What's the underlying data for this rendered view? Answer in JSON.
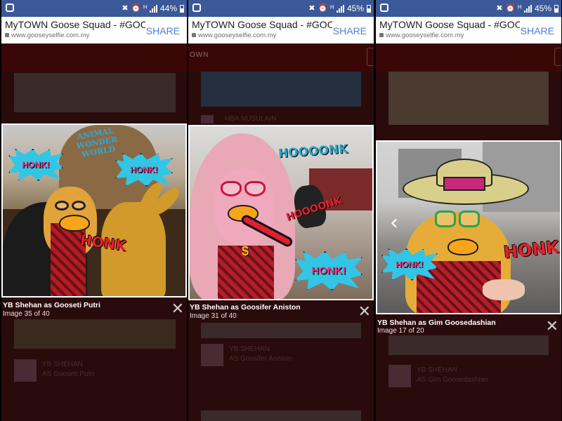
{
  "panels": [
    {
      "status": {
        "battery": "44%"
      },
      "browser": {
        "title": "MyTOWN Goose Squad - #GOOS...",
        "url": "www.gooseyselfie.com.my",
        "share": "SHARE"
      },
      "stickers": [
        "HONK!",
        "HONK!",
        "HONK"
      ],
      "sign": "ANIMAL WONDER WORLD",
      "caption": "YB Shehan as Gooseti Putri",
      "counter": "Image 35 of 40",
      "below": {
        "name_line1": "YB SHEHAN",
        "name_line2": "AS Gooseti Putri"
      }
    },
    {
      "status": {
        "battery": "45%"
      },
      "browser": {
        "title": "MyTOWN Goose Squad - #GOOS...",
        "url": "www.gooseyselfie.com.my",
        "share": "SHARE"
      },
      "top_fragment": "OWN",
      "ghost_name": "HBA NUSULAIN",
      "stickers": [
        "HOOOONK",
        "HOOOONK",
        "HONK!"
      ],
      "caption": "YB Shehan as Goosifer Aniston",
      "counter": "Image 31 of 40",
      "below": {
        "name_line1": "YB SHEHAN",
        "name_line2": "AS Goosifer Aniston"
      }
    },
    {
      "status": {
        "battery": "45%"
      },
      "browser": {
        "title": "MyTOWN Goose Squad - #GOOS...",
        "url": "www.gooseyselfie.com.my",
        "share": "SHARE"
      },
      "stickers": [
        "HONK!",
        "HONK"
      ],
      "caption": "YB Shehan as Gim Goosedashian",
      "counter": "Image 17 of 20",
      "below": {
        "name_line1": "YB SHEHAN",
        "name_line2": "AS Gim Goosedashian"
      }
    }
  ],
  "icons": {
    "close": "✕",
    "prev": "‹"
  },
  "colors": {
    "statusbar": "#3b5898",
    "share": "#4c7fd4",
    "backdrop": "#2a0b0b"
  }
}
